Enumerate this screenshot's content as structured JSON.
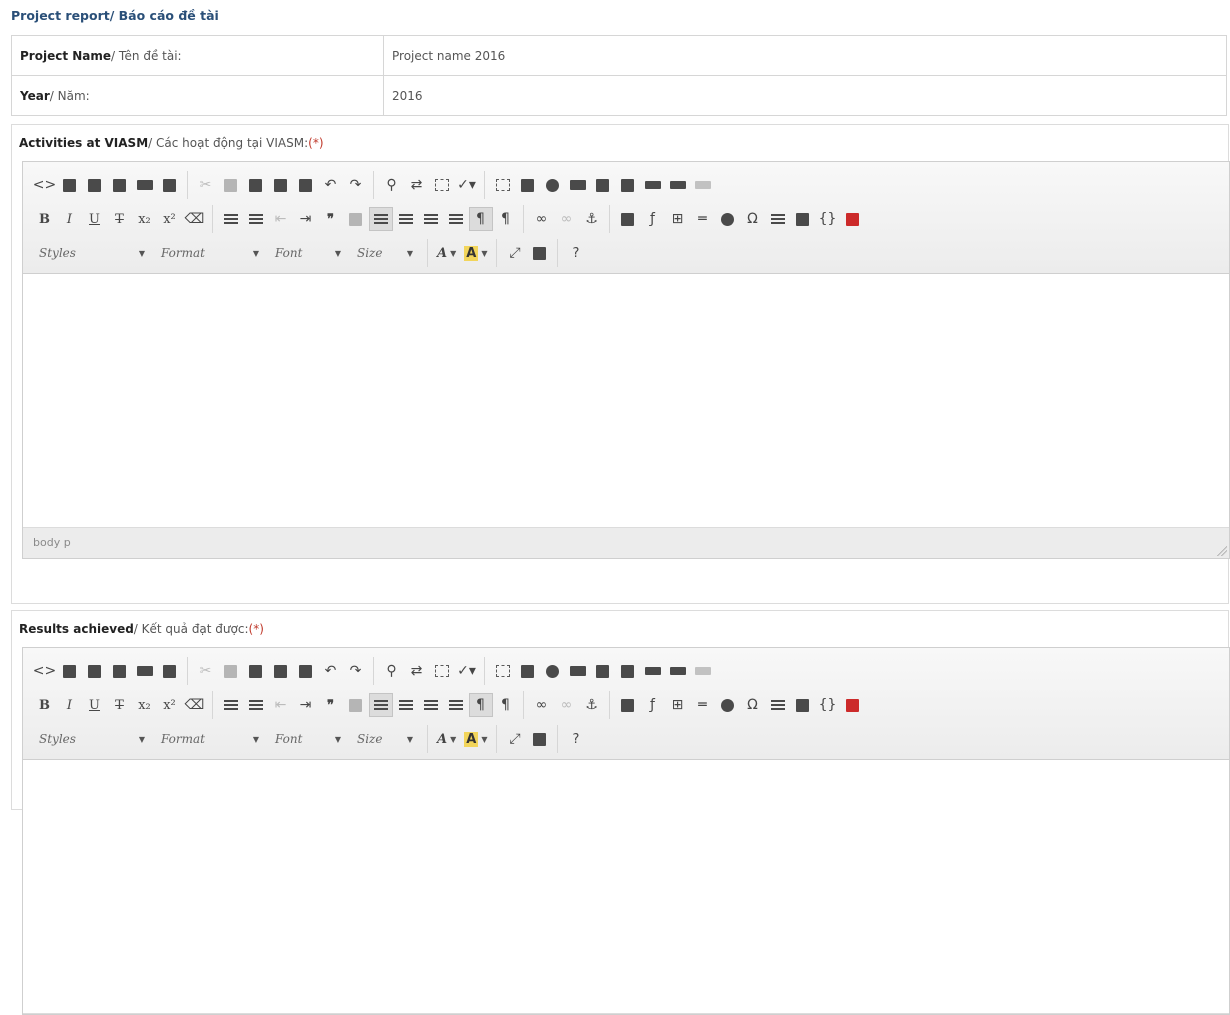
{
  "page_title": "Project report/ Báo cáo đề tài",
  "info": {
    "project_name_label_bold": "Project Name",
    "project_name_label_rest": "/ Tên đề tài:",
    "project_name_value": "Project name 2016",
    "year_label_bold": "Year",
    "year_label_rest": "/ Năm:",
    "year_value": "2016"
  },
  "sections": {
    "activities": {
      "label_bold": "Activities at VIASM",
      "label_rest": "/ Các hoạt động tại VIASM:",
      "required": "(*)",
      "status_path": "body p"
    },
    "results": {
      "label_bold": "Results achieved",
      "label_rest": "/ Kết quả đạt được:",
      "required": "(*)"
    }
  },
  "toolbar": {
    "combo_styles": "Styles",
    "combo_format": "Format",
    "combo_font": "Font",
    "combo_size": "Size",
    "text_color_glyph": "A",
    "bg_color_glyph": "A",
    "help_glyph": "?"
  },
  "icons": {
    "row1": [
      "source-icon",
      "save-icon",
      "new-page-icon",
      "preview-icon",
      "print-icon",
      "templates-icon",
      "cut-icon",
      "copy-icon",
      "paste-icon",
      "paste-text-icon",
      "paste-word-icon",
      "undo-icon",
      "redo-icon",
      "find-icon",
      "replace-icon",
      "select-all-icon",
      "spellcheck-icon",
      "form-icon",
      "checkbox-icon",
      "radio-icon",
      "textfield-icon",
      "textarea-icon",
      "select-icon",
      "button-icon",
      "image-button-icon",
      "hidden-field-icon"
    ],
    "row2": [
      "bold-icon",
      "italic-icon",
      "underline-icon",
      "strike-icon",
      "subscript-icon",
      "superscript-icon",
      "remove-format-icon",
      "numbered-list-icon",
      "bulleted-list-icon",
      "outdent-icon",
      "indent-icon",
      "blockquote-icon",
      "div-icon",
      "align-left-icon",
      "align-center-icon",
      "align-right-icon",
      "justify-icon",
      "ltr-icon",
      "rtl-icon",
      "link-icon",
      "unlink-icon",
      "anchor-icon",
      "image-icon",
      "flash-icon",
      "table-icon",
      "horizontal-rule-icon",
      "smiley-icon",
      "special-char-icon",
      "page-break-icon",
      "iframe-icon",
      "code-snippet-icon",
      "youtube-icon"
    ],
    "row3": [
      "maximize-icon",
      "show-blocks-icon",
      "help-icon"
    ]
  },
  "colors": {
    "title": "#2a4f78",
    "required": "#c0392b",
    "bg_color_swatch": "#f2d55b"
  }
}
